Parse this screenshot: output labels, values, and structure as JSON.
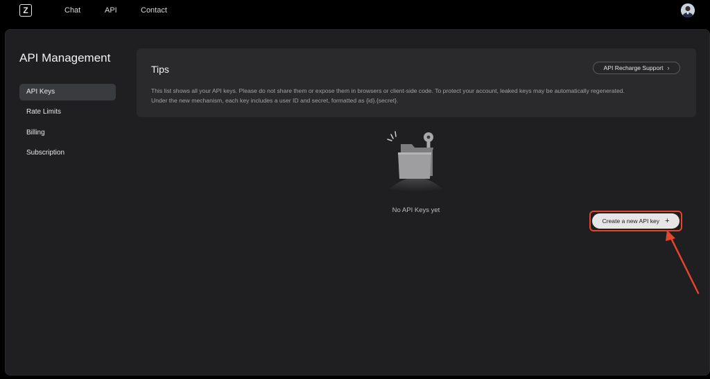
{
  "nav": {
    "logo_letter": "Z",
    "links": [
      "Chat",
      "API",
      "Contact"
    ]
  },
  "page": {
    "title": "API Management"
  },
  "sidebar": {
    "items": [
      {
        "label": "API Keys",
        "active": true
      },
      {
        "label": "Rate Limits",
        "active": false
      },
      {
        "label": "Billing",
        "active": false
      },
      {
        "label": "Subscription",
        "active": false
      }
    ]
  },
  "tips": {
    "title": "Tips",
    "text_line1": "This list shows all your API keys. Please do not share them or expose them in browsers or client-side code. To protect your account, leaked keys may be automatically regenerated.",
    "text_line2": "Under the new mechanism, each key includes a user ID and secret, formatted as {id}.{secret}.",
    "recharge_button": "API Recharge Support"
  },
  "empty_state": {
    "message": "No API Keys yet"
  },
  "actions": {
    "create_button": "Create a new API key"
  },
  "icons": {
    "chevron": "chevron-right-icon",
    "plus": "plus-icon",
    "illustration": "folder-key-icon"
  },
  "colors": {
    "background": "#000000",
    "panel": "#1f1f21",
    "card": "#2a2a2c",
    "highlight": "#e8442a",
    "button_light": "#e6e6e6"
  }
}
